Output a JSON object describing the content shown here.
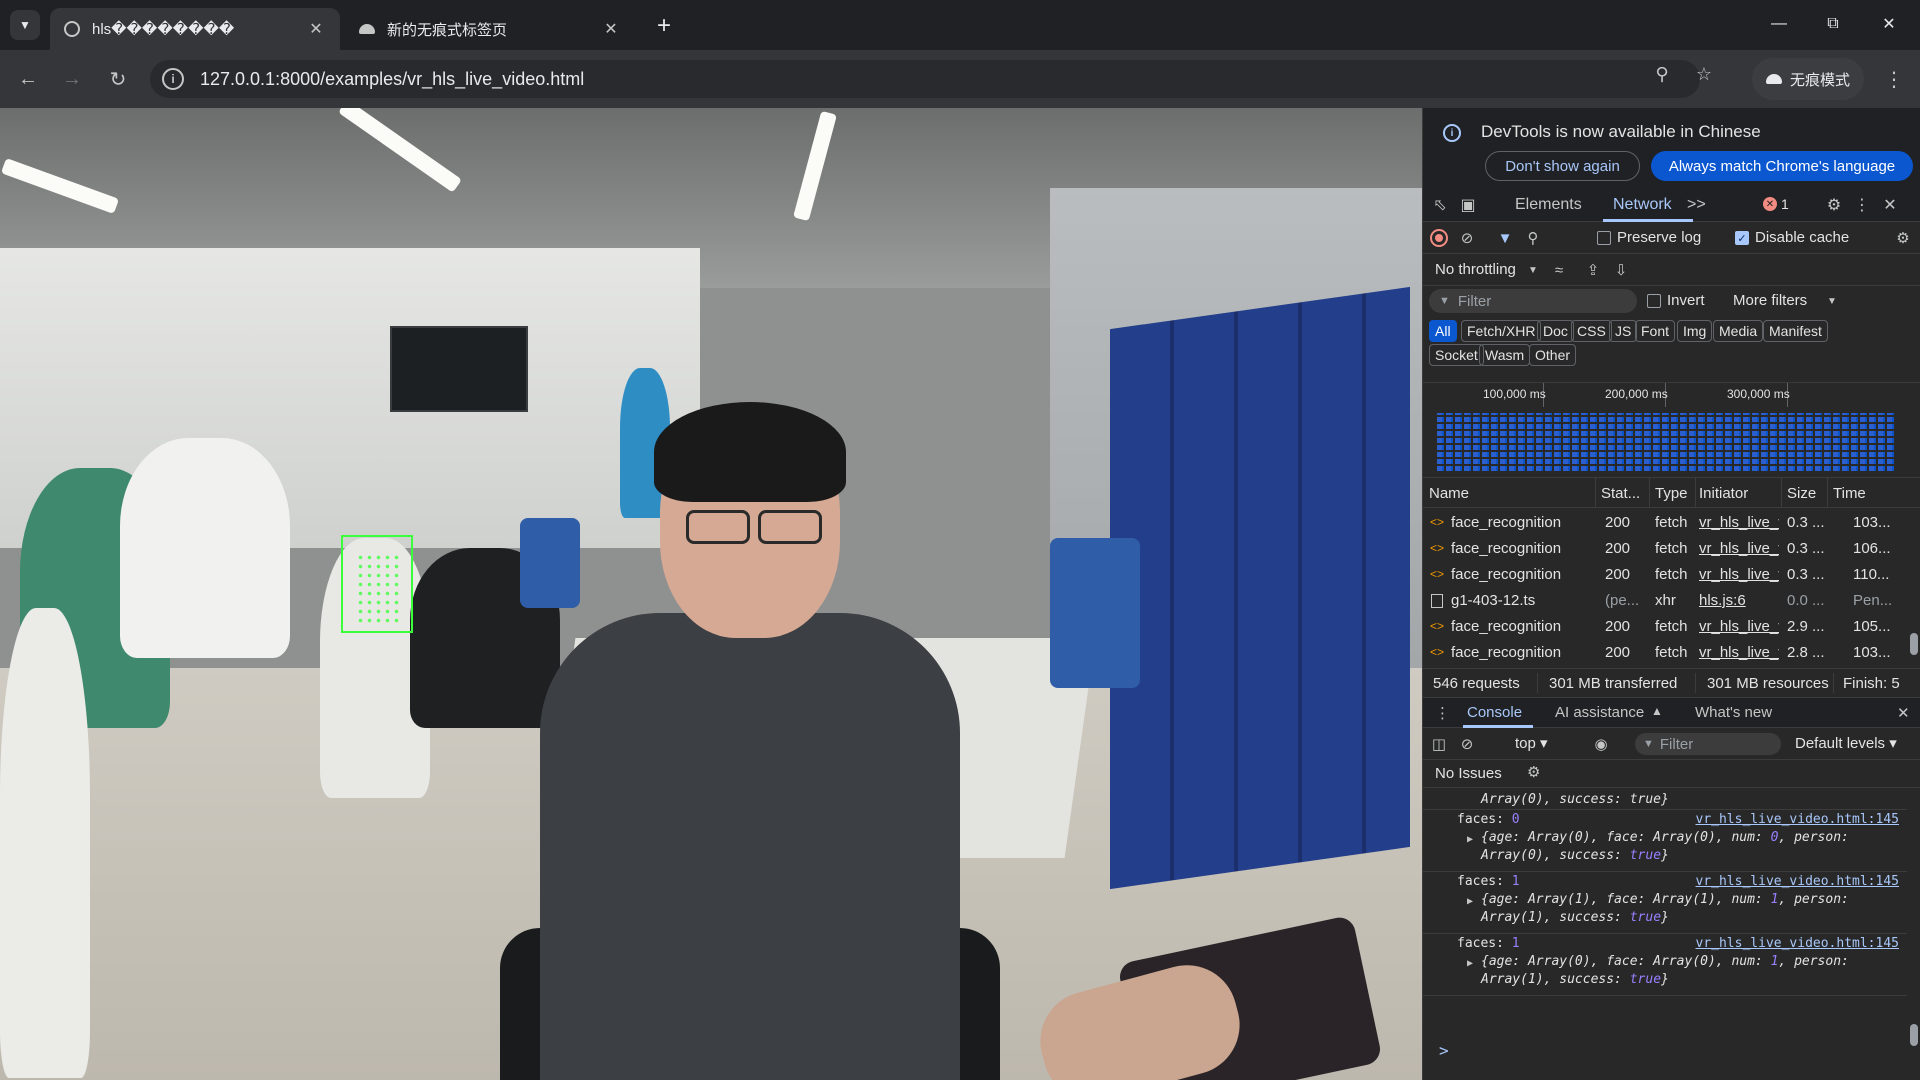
{
  "browser": {
    "tabs": [
      {
        "title": "hls��������",
        "close": "✕",
        "active": true
      },
      {
        "title": "新的无痕式标签页",
        "close": "✕",
        "active": false
      }
    ],
    "new_tab": "+",
    "url": "127.0.0.1:8000/examples/vr_hls_live_video.html",
    "incognito_label": "无痕模式",
    "icons": [
      "tab-search-icon",
      "back-icon",
      "forward-icon",
      "reload-icon",
      "site-info-icon",
      "zoom-icon",
      "star-icon",
      "incognito-icon",
      "kebab-menu-icon",
      "minimize-icon",
      "maximize-icon",
      "close-window-icon"
    ]
  },
  "devtools": {
    "banner": {
      "message": "DevTools is now available in Chinese",
      "dismiss": "Don't show again",
      "accept": "Always match Chrome's language"
    },
    "tabs": {
      "elements": "Elements",
      "network": "Network",
      "more": ">>",
      "error_count": "1"
    },
    "network": {
      "preserve_log": "Preserve log",
      "disable_cache": "Disable cache",
      "disable_cache_checked": true,
      "throttling": "No throttling",
      "filter_placeholder": "Filter",
      "invert": "Invert",
      "more_filters": "More filters",
      "type_filters": [
        "All",
        "Fetch/XHR",
        "Doc",
        "CSS",
        "JS",
        "Font",
        "Img",
        "Media",
        "Manifest",
        "Socket",
        "Wasm",
        "Other"
      ],
      "timeline_labels": [
        "100,000 ms",
        "200,000 ms",
        "300,000 ms"
      ],
      "columns": [
        "Name",
        "Stat...",
        "Type",
        "Initiator",
        "Size",
        "Time"
      ],
      "rows": [
        {
          "name": "face_recognition",
          "status": "200",
          "type": "fetch",
          "initiator": "vr_hls_live_v",
          "size": "0.3 ...",
          "time": "103..."
        },
        {
          "name": "face_recognition",
          "status": "200",
          "type": "fetch",
          "initiator": "vr_hls_live_v",
          "size": "0.3 ...",
          "time": "106..."
        },
        {
          "name": "face_recognition",
          "status": "200",
          "type": "fetch",
          "initiator": "vr_hls_live_v",
          "size": "0.3 ...",
          "time": "110..."
        },
        {
          "name": "g1-403-12.ts",
          "status": "(pe...",
          "type": "xhr",
          "initiator": "hls.js:6",
          "size": "0.0 ...",
          "time": "Pen..."
        },
        {
          "name": "face_recognition",
          "status": "200",
          "type": "fetch",
          "initiator": "vr_hls_live_v",
          "size": "2.9 ...",
          "time": "105..."
        },
        {
          "name": "face_recognition",
          "status": "200",
          "type": "fetch",
          "initiator": "vr_hls_live_v",
          "size": "2.8 ...",
          "time": "103..."
        }
      ],
      "summary": {
        "requests": "546 requests",
        "transferred": "301 MB transferred",
        "resources": "301 MB resources",
        "finish": "Finish: 5"
      }
    },
    "drawer": {
      "tabs": [
        "Console",
        "AI assistance",
        "What's new"
      ],
      "context": "top ▾",
      "filter_placeholder": "Filter",
      "levels": "Default levels ▾",
      "issues": "No Issues"
    },
    "console": {
      "partial_top": "Array(0), success: true}",
      "logs": [
        {
          "label": "faces:",
          "count": "0",
          "source": "vr_hls_live_video.html:145",
          "line1a": "{age: Array(0), face: Array(0), num: ",
          "num": "0",
          "line1b": ", person:",
          "line2a": "Array(0), success: ",
          "success": "true",
          "line2b": "}"
        },
        {
          "label": "faces:",
          "count": "1",
          "source": "vr_hls_live_video.html:145",
          "line1a": "{age: Array(1), face: Array(1), num: ",
          "num": "1",
          "line1b": ", person:",
          "line2a": "Array(1), success: ",
          "success": "true",
          "line2b": "}"
        },
        {
          "label": "faces:",
          "count": "1",
          "source": "vr_hls_live_video.html:145",
          "line1a": "{age: Array(0), face: Array(0), num: ",
          "num": "1",
          "line1b": ", person:",
          "line2a": "Array(1), success: ",
          "success": "true",
          "line2b": "}"
        }
      ],
      "prompt": ">"
    }
  },
  "colors": {
    "accent": "#a8c7fa",
    "primary_button": "#0b57d0",
    "error": "#f28b82",
    "detection_box": "#3cff3c",
    "locker_blue": "#233e8a"
  }
}
